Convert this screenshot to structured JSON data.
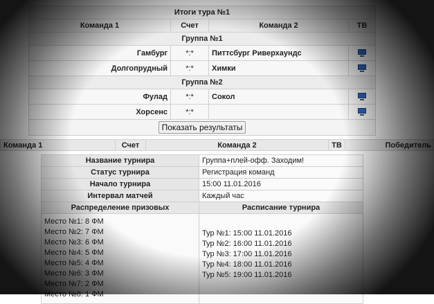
{
  "tour": {
    "title": "Итоги тура №1",
    "headers": {
      "team1": "Команда 1",
      "score": "Счет",
      "team2": "Команда 2",
      "tv": "ТВ"
    },
    "groups": [
      {
        "name": "Группа №1",
        "matches": [
          {
            "team1": "Гамбург",
            "score": "*:*",
            "team2": "Питтсбург Риверхаундс",
            "tv_icon": "tv-icon"
          },
          {
            "team1": "Долгопрудный",
            "score": "*:*",
            "team2": "Химки",
            "tv_icon": "tv-icon"
          }
        ]
      },
      {
        "name": "Группа №2",
        "matches": [
          {
            "team1": "Фулад",
            "score": "*:*",
            "team2": "Сокол",
            "tv_icon": "tv-icon"
          },
          {
            "team1": "Хорсенс",
            "score": "*:*",
            "team2": "",
            "tv_icon": "tv-icon"
          }
        ]
      }
    ],
    "show_results_label": "Показать результаты"
  },
  "matches_header": {
    "team1": "Команда 1",
    "score": "Счет",
    "team2": "Команда 2",
    "tv": "ТВ",
    "winner": "Победитель"
  },
  "info": {
    "rows": [
      {
        "label": "Название турнира",
        "value": "Группа+плей-офф. Заходим!"
      },
      {
        "label": "Статус турнира",
        "value": "Регистрация команд"
      },
      {
        "label": "Начало турнира",
        "value": "15:00 11.01.2016"
      },
      {
        "label": "Интервал матчей",
        "value": "Каждый час"
      }
    ],
    "prizes_header": "Распределение призовых",
    "schedule_header": "Расписание турнира",
    "prizes": [
      "Место №1: 8 ФМ",
      "Место №2: 7 ФМ",
      "Место №3: 6 ФМ",
      "Место №4: 5 ФМ",
      "Место №5: 4 ФМ",
      "Место №6: 3 ФМ",
      "Место №7: 2 ФМ",
      "Место №8: 1 ФМ"
    ],
    "schedule": [
      "Тур №1: 15:00 11.01.2016",
      "Тур №2: 16:00 11.01.2016",
      "Тур №3: 17:00 11.01.2016",
      "Тур №4: 18:00 11.01.2016",
      "Тур №5: 19:00 11.01.2016"
    ]
  }
}
